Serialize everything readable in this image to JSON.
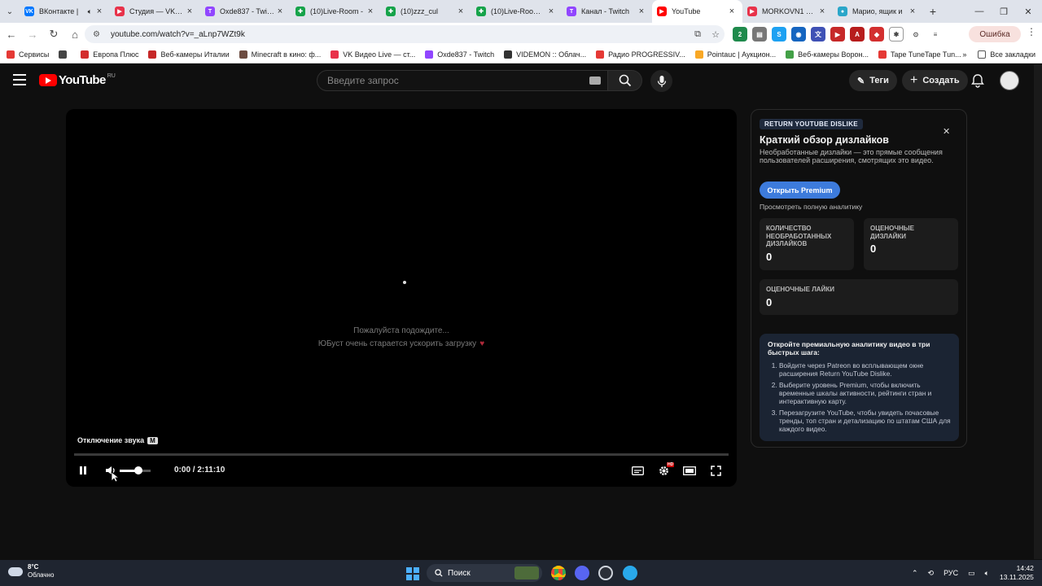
{
  "browser": {
    "tabs": [
      {
        "title": "ВКонтакте | ",
        "color": "#0077ff",
        "glyph": "VK",
        "audio": true
      },
      {
        "title": "Студия — VK Вид",
        "color": "#e8324a",
        "glyph": "▶"
      },
      {
        "title": "Oxde837 - Twitch",
        "color": "#9146ff",
        "glyph": "T"
      },
      {
        "title": "(10)Live-Room - ",
        "color": "#16a34a",
        "glyph": "✚"
      },
      {
        "title": "(10)zzz_cul",
        "color": "#16a34a",
        "glyph": "✚"
      },
      {
        "title": "(10)Live-Room - (",
        "color": "#16a34a",
        "glyph": "✚"
      },
      {
        "title": "Канал - Twitch",
        "color": "#9146ff",
        "glyph": "T"
      },
      {
        "title": "YouTube",
        "color": "#ff0000",
        "glyph": "▶",
        "active": true
      },
      {
        "title": "MORKOVN1 на V",
        "color": "#e8324a",
        "glyph": "▶"
      },
      {
        "title": "Марио, ящик и ",
        "color": "#2aa6c9",
        "glyph": "●"
      }
    ],
    "url": "youtube.com/watch?v=_aLnp7WZt9k",
    "profile_label": "Ошибка",
    "bookmarks": [
      {
        "label": "Сервисы",
        "color": "#e53935"
      },
      {
        "label": "",
        "color": "#444"
      },
      {
        "label": "Европа Плюс",
        "color": "#d32f2f"
      },
      {
        "label": "Веб-камеры Италии",
        "color": "#c62828"
      },
      {
        "label": "Minecraft в кино: ф...",
        "color": "#6d4c41"
      },
      {
        "label": "VK Видео Live — ст...",
        "color": "#e8324a"
      },
      {
        "label": "Oxde837 - Twitch",
        "color": "#9146ff"
      },
      {
        "label": "VIDEMON :: Облач...",
        "color": "#333"
      },
      {
        "label": "Радио PROGRESSIV...",
        "color": "#e53935"
      },
      {
        "label": "Pointauc | Аукцион...",
        "color": "#f9a825"
      },
      {
        "label": "Веб-камеры Ворон...",
        "color": "#43a047"
      },
      {
        "label": "Tape TuneTape Tun...",
        "color": "#e53935"
      }
    ],
    "all_bookmarks": "Все закладки"
  },
  "youtube": {
    "logo_text": "YouTube",
    "logo_region": "RU",
    "search_placeholder": "Введите запрос",
    "tags_label": "Теги",
    "create_label": "Создать"
  },
  "player": {
    "wait_line1": "Пожалуйста подождите...",
    "wait_line2": "ЮБуст очень старается ускорить загрузку",
    "mute_tooltip": "Отключение звука",
    "mute_key": "M",
    "time": "0:00 / 2:11:10",
    "hd_badge": "HD",
    "volume_level": 0.6,
    "progress": 0.0
  },
  "dislike_panel": {
    "tag": "RETURN YOUTUBE DISLIKE",
    "title": "Краткий обзор дизлайков",
    "description": "Необработанные дизлайки — это прямые сообщения пользователей расширения, смотрящих это видео.",
    "premium_button": "Открыть Premium",
    "full_analytics_link": "Просмотреть полную аналитику",
    "stats": [
      {
        "label": "Количество необработанных дизлайков",
        "value": "0"
      },
      {
        "label": "Оценочные дизлайки",
        "value": "0"
      },
      {
        "label": "Оценочные лайки",
        "value": "0"
      }
    ],
    "info_heading": "Откройте премиальную аналитику видео в три быстрых шага:",
    "info_steps": [
      "Войдите через Patreon во всплывающем окне расширения Return YouTube Dislike.",
      "Выберите уровень Premium, чтобы включить временные шкалы активности, рейтинги стран и интерактивную карту.",
      "Перезагрузите YouTube, чтобы увидеть почасовые тренды, топ стран и детализацию по штатам США для каждого видео."
    ]
  },
  "taskbar": {
    "weather_temp": "8°C",
    "weather_text": "Облачно",
    "search_label": "Поиск",
    "lang": "РУС",
    "time": "14:42",
    "date": "13.11.2025"
  }
}
